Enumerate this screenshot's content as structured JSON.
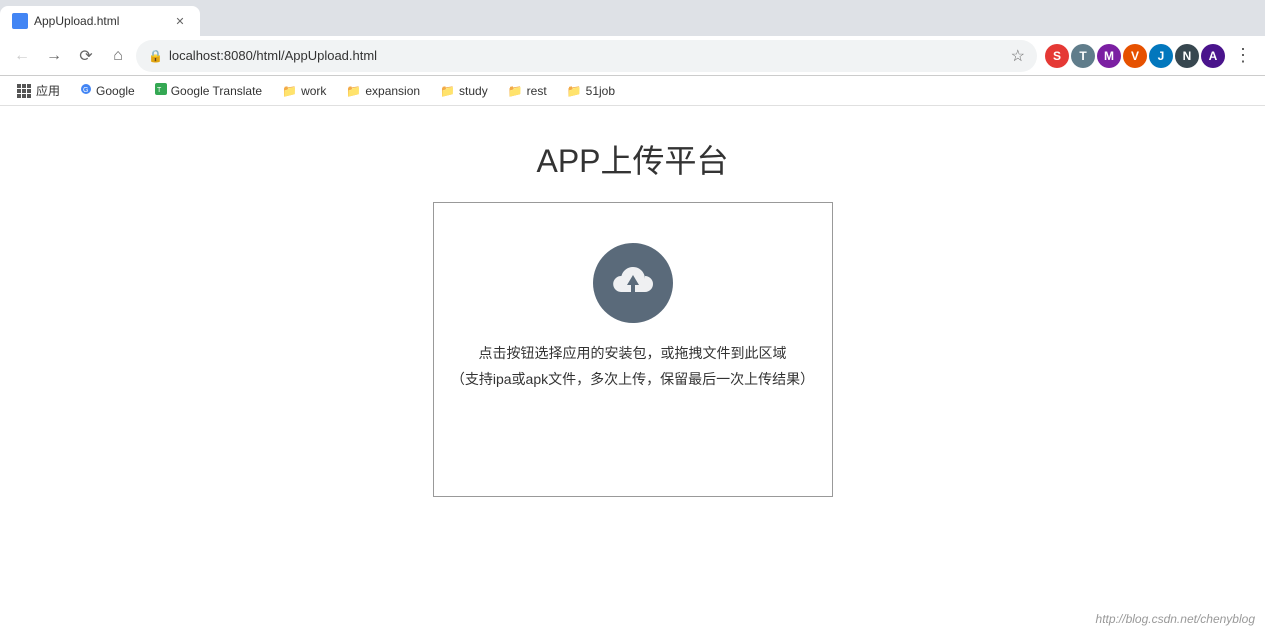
{
  "browser": {
    "tab_title": "AppUpload.html",
    "address": "localhost:8080/html/AppUpload.html"
  },
  "bookmarks": [
    {
      "id": "apps",
      "label": "应用",
      "type": "apps"
    },
    {
      "id": "google",
      "label": "Google",
      "type": "bookmark"
    },
    {
      "id": "google-translate",
      "label": "Google Translate",
      "type": "bookmark"
    },
    {
      "id": "work",
      "label": "work",
      "type": "folder"
    },
    {
      "id": "expansion",
      "label": "expansion",
      "type": "folder"
    },
    {
      "id": "study",
      "label": "study",
      "type": "folder"
    },
    {
      "id": "rest",
      "label": "rest",
      "type": "folder"
    },
    {
      "id": "51job",
      "label": "51job",
      "type": "folder"
    }
  ],
  "page": {
    "title": "APP上传平台",
    "upload_main_text": "点击按钮选择应用的安装包，或拖拽文件到此区域",
    "upload_sub_text": "（支持ipa或apk文件，多次上传，保留最后一次上传结果）",
    "watermark": "http://blog.csdn.net/chenyblog"
  },
  "extensions": [
    {
      "id": "ext1",
      "color": "#e53935",
      "label": "S"
    },
    {
      "id": "ext2",
      "color": "#607d8b",
      "label": "T"
    },
    {
      "id": "ext3",
      "color": "#7b1fa2",
      "label": "M"
    },
    {
      "id": "ext4",
      "color": "#e65100",
      "label": "V"
    },
    {
      "id": "ext5",
      "color": "#0277bd",
      "label": "J"
    },
    {
      "id": "ext6",
      "color": "#37474f",
      "label": "N"
    },
    {
      "id": "ext7",
      "color": "#4a148c",
      "label": "A"
    }
  ]
}
